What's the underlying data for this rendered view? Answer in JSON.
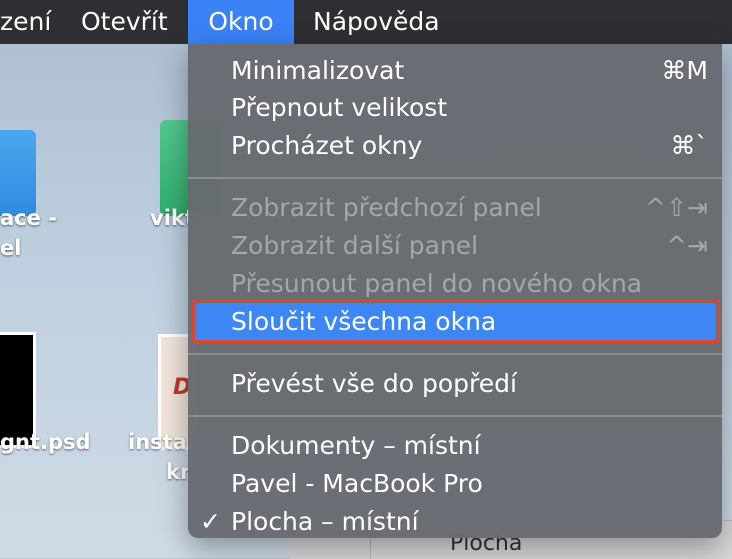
{
  "menubar": {
    "items": [
      {
        "label": "zení"
      },
      {
        "label": "Otevřít"
      },
      {
        "label": "Okno"
      },
      {
        "label": "Nápověda"
      }
    ]
  },
  "desktop": {
    "items": [
      {
        "label_line1": "ace -",
        "label_line2": "el"
      },
      {
        "label": "vikt"
      },
      {
        "label": "gnt.psd"
      },
      {
        "label_line1": "insta",
        "label_line2": "kr"
      }
    ],
    "doc_thumb_text": "D",
    "finder_text": "Plocha"
  },
  "menu": {
    "items": [
      {
        "label": "Minimalizovat",
        "shortcut": "⌘M",
        "enabled": true
      },
      {
        "label": "Přepnout velikost",
        "shortcut": "",
        "enabled": true
      },
      {
        "label": "Procházet okny",
        "shortcut": "⌘`",
        "enabled": true
      },
      {
        "label": "Zobrazit předchozí panel",
        "shortcut": "^⇧⇥",
        "enabled": false
      },
      {
        "label": "Zobrazit další panel",
        "shortcut": "^⇥",
        "enabled": false
      },
      {
        "label": "Přesunout panel do nového okna",
        "shortcut": "",
        "enabled": false
      },
      {
        "label": "Sloučit všechna okna",
        "shortcut": "",
        "enabled": true,
        "highlighted": true
      },
      {
        "label": "Převést vše do popředí",
        "shortcut": "",
        "enabled": true
      },
      {
        "label": "Dokumenty – místní",
        "shortcut": "",
        "enabled": true
      },
      {
        "label": "Pavel - MacBook Pro",
        "shortcut": "",
        "enabled": true
      },
      {
        "label": "Plocha – místní",
        "shortcut": "",
        "enabled": true,
        "checked": true,
        "check_mark": "✓"
      }
    ]
  },
  "colors": {
    "menubar_bg": "#2e2f33",
    "menu_bg": "#676a6f",
    "highlight": "#3d87f5",
    "annotation_box": "#d9472f",
    "disabled_text": "#a4a6ab"
  }
}
